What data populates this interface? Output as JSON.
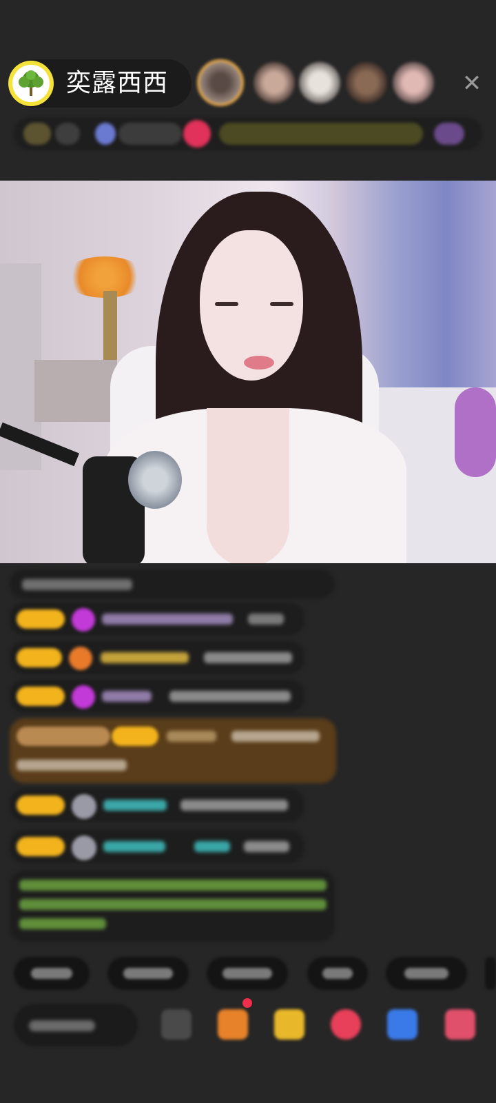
{
  "header": {
    "anchor_name": "奕露西西",
    "close_icon": "close-icon",
    "viewer_avatars": [
      "viewer-1",
      "viewer-2",
      "viewer-3",
      "viewer-4",
      "viewer-5"
    ]
  },
  "colors": {
    "background": "#262626",
    "avatar_ring": "#f4e13a",
    "gift_badge": "#f2b31d",
    "chat_green": "#83c34d",
    "highlight_bg": "#5a3d1a"
  },
  "chat": {
    "messages": [
      "message-1",
      "message-2",
      "message-3",
      "message-4",
      "message-5",
      "message-6",
      "message-7",
      "message-8"
    ]
  },
  "quick_actions": [
    "quick-1",
    "quick-2",
    "quick-3",
    "quick-4",
    "quick-5"
  ],
  "toolbar_icons": [
    "more-icon",
    "gift-box-icon",
    "treasure-icon",
    "heart-icon",
    "game-icon",
    "bag-icon"
  ]
}
